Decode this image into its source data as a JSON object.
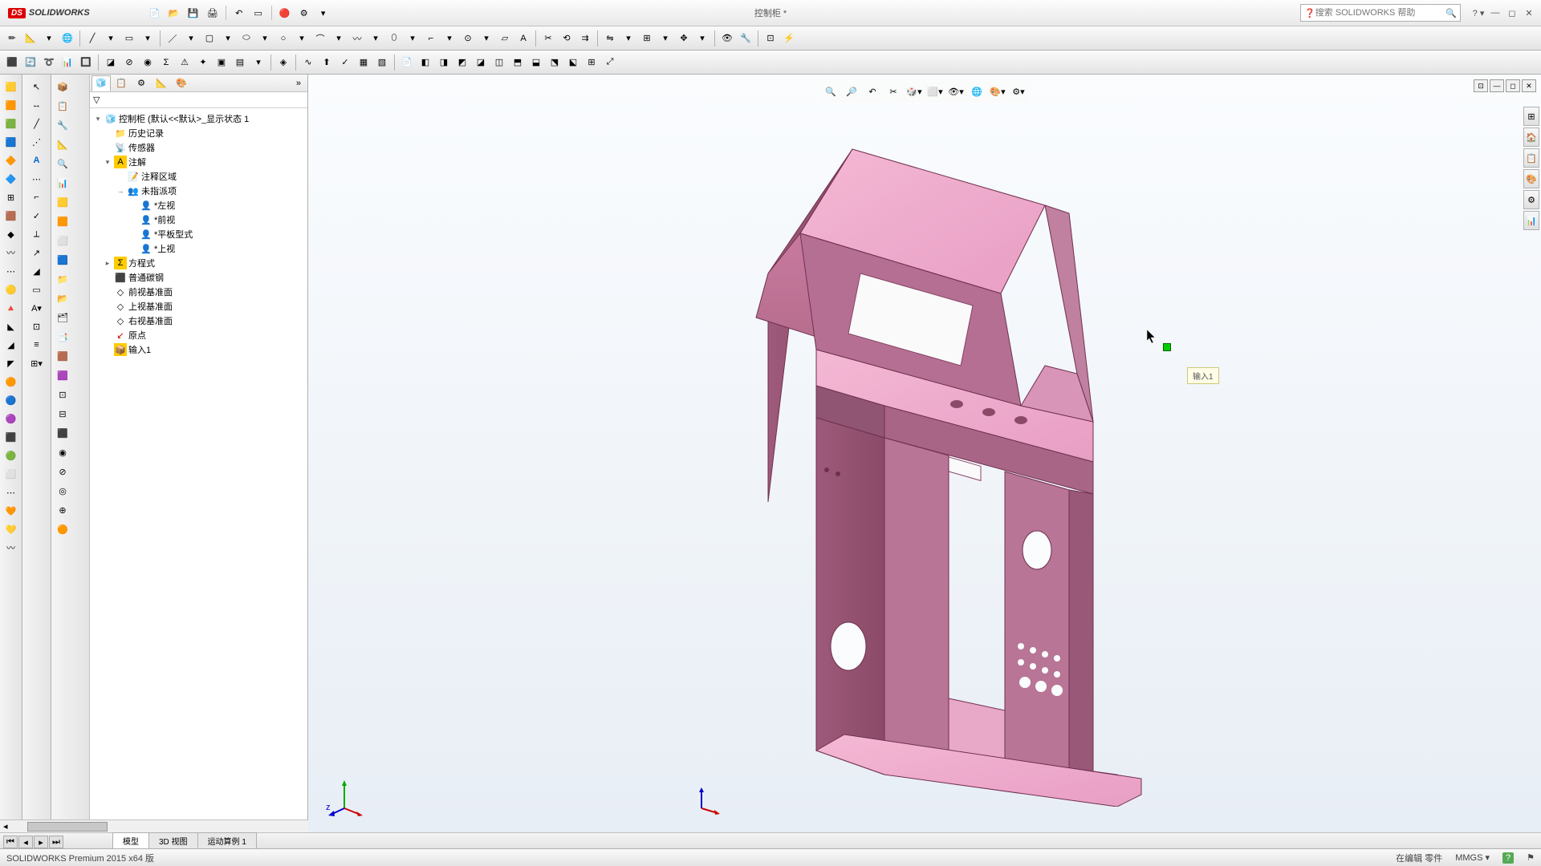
{
  "app": {
    "name": "SOLIDWORKS",
    "doc_title": "控制柜 *"
  },
  "search": {
    "placeholder": "搜索 SOLIDWORKS 帮助"
  },
  "tree": {
    "root": "控制柜 (默认<<默认>_显示状态 1",
    "history": "历史记录",
    "sensors": "传感器",
    "annotations": "注解",
    "ann_area": "注释区域",
    "unassigned": "未指派项",
    "left_view": "*左视",
    "front_view": "*前视",
    "flat_pattern": "*平板型式",
    "top_view": "*上视",
    "equations": "方程式",
    "material": "普通碳钢",
    "front_plane": "前视基准面",
    "top_plane": "上视基准面",
    "right_plane": "右视基准面",
    "origin": "原点",
    "import1": "输入1"
  },
  "bottom_tabs": {
    "model": "模型",
    "view3d": "3D 视图",
    "motion": "运动算例 1"
  },
  "status": {
    "version": "SOLIDWORKS Premium 2015 x64 版",
    "editing": "在编辑 零件",
    "units": "MMGS"
  },
  "tooltip": "输入1"
}
